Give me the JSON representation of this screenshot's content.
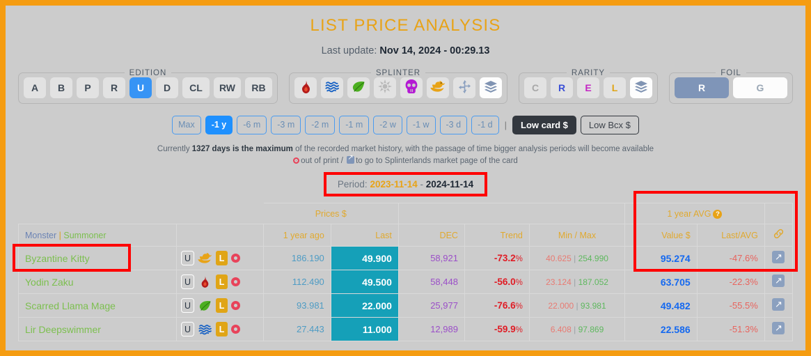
{
  "header": {
    "title": "LIST PRICE ANALYSIS",
    "update_label": "Last update:",
    "update_value": "Nov 14, 2024 - 00:29.13"
  },
  "filters": {
    "edition": {
      "legend": "EDITION",
      "options": [
        "A",
        "B",
        "P",
        "R",
        "U",
        "D",
        "CL",
        "RW",
        "RB"
      ],
      "selected": "U"
    },
    "splinter": {
      "legend": "SPLINTER",
      "options": [
        "fire",
        "water",
        "earth",
        "life",
        "death",
        "dragon",
        "neutral",
        "all"
      ],
      "selected": "all"
    },
    "rarity": {
      "legend": "RARITY",
      "options": [
        "C",
        "R",
        "E",
        "L",
        "all"
      ],
      "selected": "all"
    },
    "foil": {
      "legend": "FOIL",
      "options": [
        "R",
        "G"
      ],
      "selected": "R"
    }
  },
  "period_buttons": {
    "ranges": [
      "Max",
      "-1 y",
      "-6 m",
      "-3 m",
      "-2 m",
      "-1 m",
      "-2 w",
      "-1 w",
      "-3 d",
      "-1 d"
    ],
    "selected_range": "-1 y",
    "low_card": "Low card $",
    "low_bcx": "Low Bcx $",
    "selected_low": "Low card $"
  },
  "notes": {
    "line1_pre": "Currently ",
    "line1_bold": "1327 days is the maximum",
    "line1_post": " of the recorded market history, with the passage of time bigger analysis periods will become available",
    "line2_a": "out of print / ",
    "line2_b": "to go to Splinterlands market page of the card"
  },
  "period_banner": {
    "label": "Period:",
    "from": "2023-11-14",
    "dash": "-",
    "to": "2024-11-14"
  },
  "table": {
    "group_headers": {
      "prices": "Prices $",
      "avg": "1 year AVG",
      "avg_help": "?"
    },
    "columns": {
      "monster": "Monster",
      "divider": "|",
      "summoner": "Summoner",
      "year_ago": "1 year ago",
      "last": "Last",
      "dec": "DEC",
      "trend": "Trend",
      "minmax": "Min / Max",
      "value": "Value $",
      "last_avg": "Last/AVG",
      "link_icon": "link-icon"
    },
    "rows": [
      {
        "name": "Byzantine Kitty",
        "edition": "U",
        "splinter": "dragon",
        "rarity": "L",
        "out_of_print": true,
        "year_ago": "186.190",
        "last": "49.900",
        "dec": "58,921",
        "trend": "-73.2",
        "trend_pct": "%",
        "min": "40.625",
        "max": "254.990",
        "value": "95.274",
        "last_avg": "-47.6%"
      },
      {
        "name": "Yodin Zaku",
        "edition": "U",
        "splinter": "fire",
        "rarity": "L",
        "out_of_print": true,
        "year_ago": "112.490",
        "last": "49.500",
        "dec": "58,448",
        "trend": "-56.0",
        "trend_pct": "%",
        "min": "23.124",
        "max": "187.052",
        "value": "63.705",
        "last_avg": "-22.3%"
      },
      {
        "name": "Scarred Llama Mage",
        "edition": "U",
        "splinter": "earth",
        "rarity": "L",
        "out_of_print": true,
        "year_ago": "93.981",
        "last": "22.000",
        "dec": "25,977",
        "trend": "-76.6",
        "trend_pct": "%",
        "min": "22.000",
        "max": "93.981",
        "value": "49.482",
        "last_avg": "-55.5%"
      },
      {
        "name": "Lir Deepswimmer",
        "edition": "U",
        "splinter": "water",
        "rarity": "L",
        "out_of_print": true,
        "year_ago": "27.443",
        "last": "11.000",
        "dec": "12,989",
        "trend": "-59.9",
        "trend_pct": "%",
        "min": "6.408",
        "max": "97.869",
        "value": "22.586",
        "last_avg": "-51.3%"
      }
    ]
  },
  "colors": {
    "page_border": "#f59c11",
    "background": "#cccccc",
    "title": "#e8a317",
    "accent_blue": "#1e90ff",
    "last_cell": "#15a0b8",
    "value_blue": "#1569f0",
    "trend_red": "#e01b24",
    "annotation": "#ff0000"
  }
}
